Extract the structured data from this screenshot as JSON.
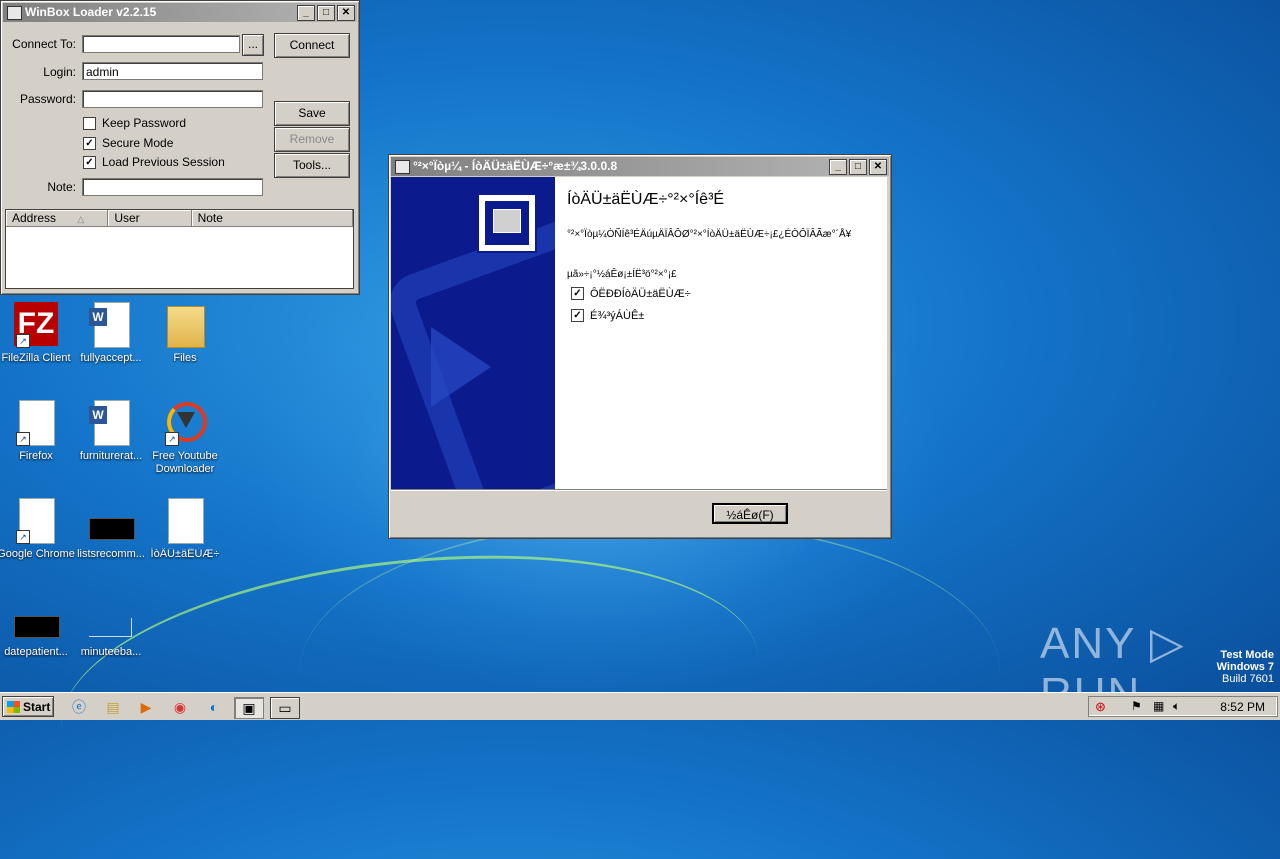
{
  "winbox": {
    "title": "WinBox Loader v2.2.15",
    "connect_to_label": "Connect To:",
    "connect_to_value": "",
    "browse_label": "...",
    "login_label": "Login:",
    "login_value": "admin",
    "password_label": "Password:",
    "password_value": "",
    "keep_password": "Keep Password",
    "secure_mode": "Secure Mode",
    "load_previous_session": "Load Previous Session",
    "note_label": "Note:",
    "note_value": "",
    "connect_button": "Connect",
    "save_button": "Save",
    "remove_button": "Remove",
    "tools_button": "Tools...",
    "columns": [
      "Address",
      "User",
      "Note"
    ]
  },
  "installer": {
    "title": "°²×°Ïòµ¼ - ÍòÄÜ±äËÙÆ÷°æ±¾3.0.0.8",
    "heading": "ÍòÄÜ±äËÙÆ÷°²×°Íê³É",
    "description": "°²×°Ïòµ¼ÒÑÍê³ÉÄúµÄÏÂÔØ°²×°ÍòÄÜ±äËÙÆ÷¡£¿ÉÒÔÏÂÃæ°´Å¥",
    "prompt": "µã»÷¡°½áÊø¡±ÍË³ö°²×°¡£",
    "option1": "ÔËÐÐÍòÄÜ±äËÙÆ÷",
    "option2": "É¾³ýÁÙÊ±",
    "finish_button": "½áÊø(F)"
  },
  "desktop_icons": [
    {
      "label": "FileZilla Client"
    },
    {
      "label": "fullyaccept..."
    },
    {
      "label": "Files"
    },
    {
      "label": "Firefox"
    },
    {
      "label": "furniturerat..."
    },
    {
      "label": "Free Youtube Downloader"
    },
    {
      "label": "Google Chrome"
    },
    {
      "label": "listsrecomm..."
    },
    {
      "label": "ÍòÄÜ±äËÙÆ÷"
    },
    {
      "label": "datepatient..."
    },
    {
      "label": "minuteeba..."
    }
  ],
  "taskbar": {
    "start_label": "Start",
    "clock": "8:52 PM"
  },
  "watermark": {
    "line1": "Test Mode",
    "line2": "Windows 7",
    "line3": "Build 7601",
    "brand": "ANY ▷ RUN"
  },
  "colors": {
    "installer_banner": "#0b1a8c",
    "desktop_blue": "#1474c9"
  }
}
